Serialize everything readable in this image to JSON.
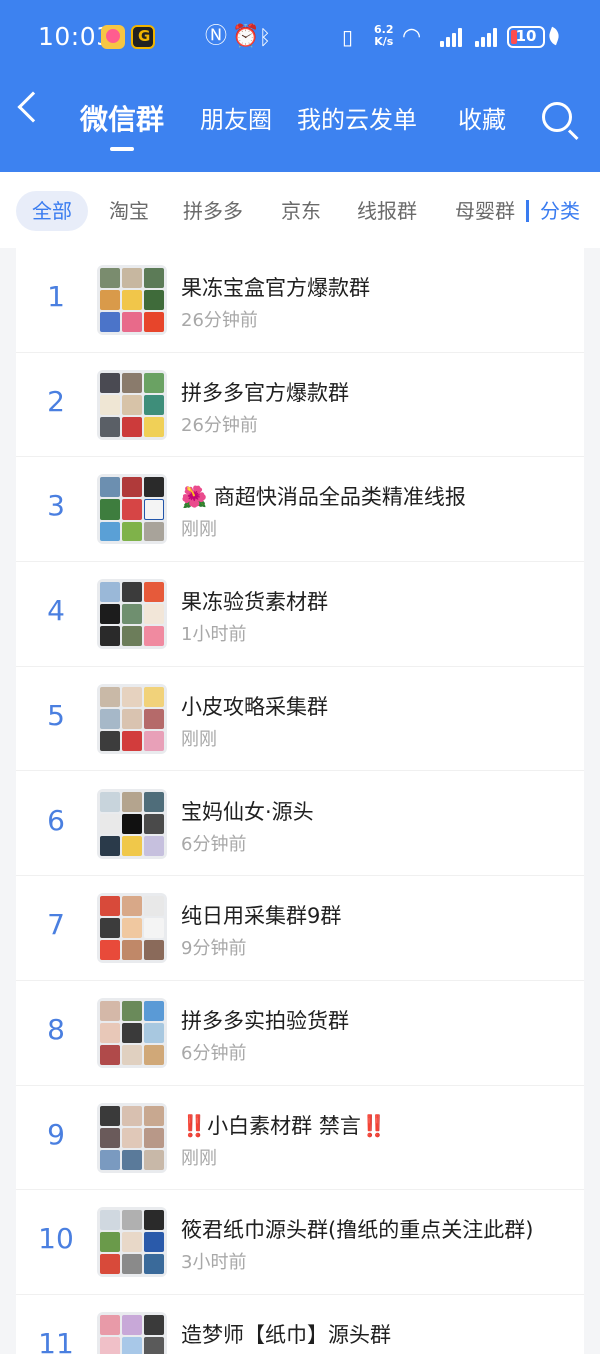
{
  "status_bar": {
    "time": "10:03",
    "net_speed_value": "6.2",
    "net_speed_unit": "K/s",
    "battery": "10"
  },
  "nav": {
    "tabs": [
      {
        "label": "微信群",
        "active": true
      },
      {
        "label": "朋友圈",
        "active": false
      },
      {
        "label": "我的云发单",
        "active": false
      },
      {
        "label": "收藏",
        "active": false
      }
    ]
  },
  "categories": {
    "items": [
      {
        "label": "全部",
        "active": true
      },
      {
        "label": "淘宝",
        "active": false
      },
      {
        "label": "拼多多",
        "active": false
      },
      {
        "label": "京东",
        "active": false
      },
      {
        "label": "线报群",
        "active": false
      },
      {
        "label": "母婴群",
        "active": false
      }
    ],
    "more_label": "分类"
  },
  "groups": [
    {
      "rank": "1",
      "name": "果冻宝盒官方爆款群",
      "time": "26分钟前"
    },
    {
      "rank": "2",
      "name": "拼多多官方爆款群",
      "time": "26分钟前"
    },
    {
      "rank": "3",
      "name": "🌺 商超快消品全品类精准线报",
      "time": "刚刚"
    },
    {
      "rank": "4",
      "name": "果冻验货素材群",
      "time": "1小时前"
    },
    {
      "rank": "5",
      "name": "小皮攻略采集群",
      "time": "刚刚"
    },
    {
      "rank": "6",
      "name": "宝妈仙女·源头",
      "time": "6分钟前"
    },
    {
      "rank": "7",
      "name": "纯日用采集群9群",
      "time": "9分钟前"
    },
    {
      "rank": "8",
      "name": "拼多多实拍验货群",
      "time": "6分钟前"
    },
    {
      "rank": "9",
      "name": "‼️小白素材群 禁言‼️",
      "time": "刚刚"
    },
    {
      "rank": "10",
      "name": "筱君纸巾源头群(撸纸的重点关注此群)",
      "time": "3小时前"
    },
    {
      "rank": "11",
      "name": "造梦师【纸巾】源头群",
      "time": ""
    }
  ],
  "colors": {
    "header_bg": "#3d82f0",
    "accent": "#3a7cf0",
    "rank": "#4a7fe0"
  }
}
